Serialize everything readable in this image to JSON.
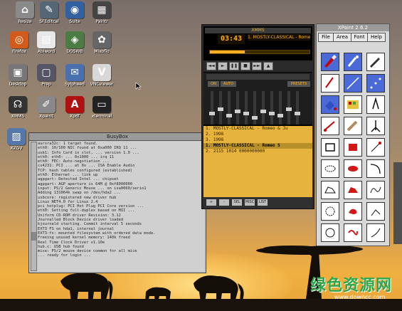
{
  "desktop": {
    "icons": [
      {
        "name": "icon-1",
        "label": "Resize",
        "color": "#8a8a8a",
        "glyph": "⌂",
        "l": 10,
        "t": 2
      },
      {
        "name": "icon-2",
        "label": "SFEditcal",
        "color": "#556677",
        "glyph": "✎",
        "l": 44,
        "t": 2
      },
      {
        "name": "icon-3",
        "label": "Suite",
        "color": "#3360a0",
        "glyph": "◉",
        "l": 80,
        "t": 2
      },
      {
        "name": "icon-4",
        "label": "Paintr",
        "color": "#444",
        "glyph": "▦",
        "l": 118,
        "t": 2
      },
      {
        "name": "icon-5",
        "label": "Firefox",
        "color": "#d25a1a",
        "glyph": "◎",
        "l": 2,
        "t": 44
      },
      {
        "name": "icon-6",
        "label": "Abiword",
        "color": "#e8e8e8",
        "glyph": "▤",
        "l": 40,
        "t": 44
      },
      {
        "name": "icon-7",
        "label": "DOSWB",
        "color": "#4b7c44",
        "glyph": "◈",
        "l": 80,
        "t": 44
      },
      {
        "name": "icon-8",
        "label": "Mixoflo",
        "color": "#666",
        "glyph": "✿",
        "l": 118,
        "t": 44
      },
      {
        "name": "icon-9",
        "label": "Desktop",
        "color": "#777",
        "glyph": "▣",
        "l": 0,
        "t": 90
      },
      {
        "name": "icon-10",
        "label": "Prep",
        "color": "#556",
        "glyph": "▢",
        "l": 40,
        "t": 90
      },
      {
        "name": "icon-11",
        "label": "Sylpheed",
        "color": "#4a70b0",
        "glyph": "✉",
        "l": 80,
        "t": 90
      },
      {
        "name": "icon-12",
        "label": "VNCviewer",
        "color": "#d8d8d8",
        "glyph": "V",
        "l": 118,
        "t": 90
      },
      {
        "name": "icon-13",
        "label": "XMMS",
        "color": "#333",
        "glyph": "☊",
        "l": 0,
        "t": 135
      },
      {
        "name": "icon-14",
        "label": "Xpaint",
        "color": "#888",
        "glyph": "✐",
        "l": 40,
        "t": 135
      },
      {
        "name": "icon-15",
        "label": "Xpdf",
        "color": "#b01010",
        "glyph": "A",
        "l": 80,
        "t": 135
      },
      {
        "name": "icon-16",
        "label": "xterminal",
        "color": "#222",
        "glyph": "▭",
        "l": 118,
        "t": 135
      },
      {
        "name": "icon-17",
        "label": "XZGV",
        "color": "#5577aa",
        "glyph": "▨",
        "l": -2,
        "t": 180
      }
    ]
  },
  "terminal": {
    "title": "BusyBox",
    "lines": [
      "aurora32c: 1 target found.",
      "eth0: 10/100 NIC found at 0xa000 IRQ 11 ...",
      "usb1: Info Card in slot, ... version 1.0 ...",
      "eth0: eth0: ... 0x1000 ... irq 11",
      "eth0: FEC: Auto-negotiation ...",
      "cs4231: PCI ... at 0x ... ISA Enable Audio",
      "TCP: hash tables configured (established)",
      "eth0: Ethernet ... link up",
      "agpgart: Detected Intel ... chipset",
      "agpgart: AGP aperture is 64M @ 0xf8000000",
      "input: PS/2 Generic Mouse ... on isa0060/serio1",
      "Adding 131064k swap on /dev/hda2 ...",
      "usbcore: registered new driver hub",
      "Linux NET4.0 for Linux 2.4",
      "pci_hotplug: PCI Hot Plug PCI Core version ...",
      "eth0: Setting full-duplex based on MII ...",
      "Uniform CD-ROM driver Revision: 3.12",
      "Journalled Block Device driver loaded",
      "kjournald starting. Commit interval 5 seconds",
      "EXT3 FS on hda1, internal journal",
      "EXT3-fs: mounted filesystem with ordered data mode.",
      "Freeing unused kernel memory: 140k freed",
      "Real Time Clock Driver v1.10e",
      "hub.c: USB hub found",
      "mice: PS/2 mouse device common for all mice",
      "... ready for login ..."
    ]
  },
  "player": {
    "title": "XMMS",
    "time": "03:43",
    "marquee": "1. MOSTLY-CLASSICAL - Romeo S",
    "progress": 0.35,
    "controls": [
      "◄◄",
      "►",
      "❚❚",
      "■",
      "►►",
      "▲"
    ],
    "eq": {
      "on": "ON",
      "auto": "AUTO",
      "presets": "PRESETS",
      "levels": [
        0.5,
        0.6,
        0.45,
        0.55,
        0.5,
        0.4,
        0.55,
        0.5,
        0.45,
        0.6,
        0.5
      ]
    },
    "playlist": [
      {
        "text": "1. MOSTLY-CLASSICAL - Romeo & Ju",
        "sel": false
      },
      {
        "text": "2. 1998",
        "sel": false
      },
      {
        "text": "3. 1998",
        "sel": false
      },
      {
        "text": "1. MOSTLY-CLASSICAL - Romeo S",
        "sel": true
      },
      {
        "text": "2. 2115 1014 0000000000",
        "sel": false
      }
    ],
    "footer": [
      "+",
      "-",
      "SEL",
      "MISC",
      "LIST"
    ]
  },
  "paint": {
    "title": "XPaint 2.6.2",
    "menu": [
      "File",
      "Area",
      "Font",
      "Help"
    ]
  },
  "watermark": {
    "cn": "绿色资源网",
    "url": "www.downcc.com"
  }
}
